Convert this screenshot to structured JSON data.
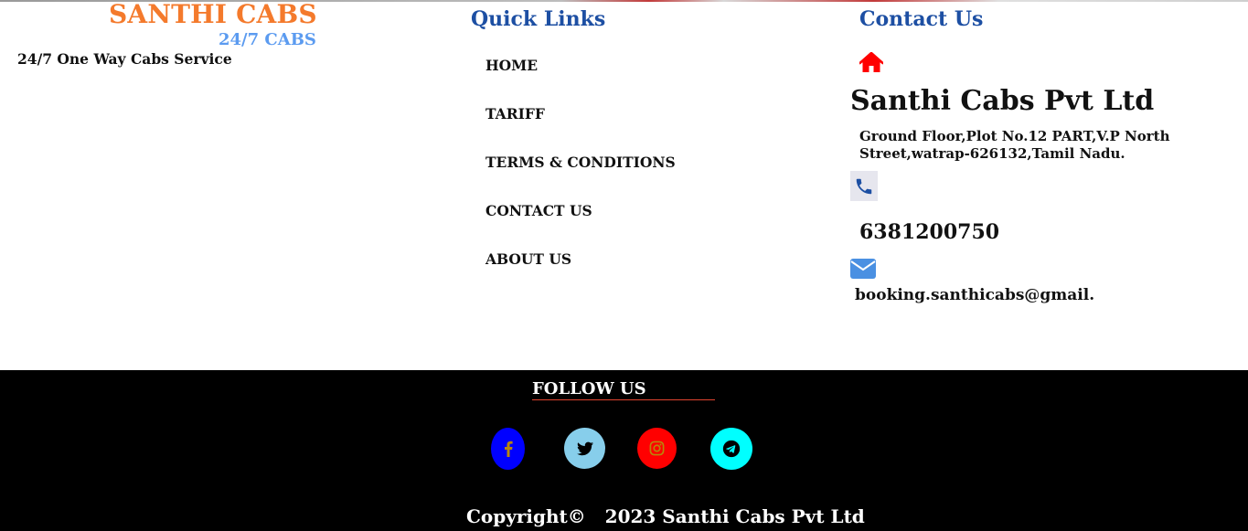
{
  "brand": {
    "title": "SANTHI CABS",
    "subtitle": "24/7 CABS",
    "tagline": "24/7 One Way Cabs Service",
    "title_color": "#f47a2c",
    "subtitle_color": "#5b9bf0"
  },
  "quick_links": {
    "heading": "Quick Links",
    "items": [
      {
        "label": "HOME"
      },
      {
        "label": "TARIFF"
      },
      {
        "label": "TERMS & CONDITIONS"
      },
      {
        "label": "CONTACT US"
      },
      {
        "label": "ABOUT US"
      }
    ]
  },
  "contact": {
    "heading": "Contact Us",
    "home_icon": "home-icon",
    "company": "Santhi Cabs Pvt Ltd",
    "address": "Ground Floor,Plot No.12 PART,V.P North Street,watrap-626132,Tamil Nadu.",
    "phone_icon": "phone-icon",
    "phone": "6381200750",
    "mail_icon": "envelope-icon",
    "email": "booking.santhicabs@gmail."
  },
  "footer": {
    "follow_label": "FOLLOW US",
    "social": [
      {
        "name": "facebook-icon",
        "color": "#0000ff"
      },
      {
        "name": "twitter-icon",
        "color": "#87ceeb"
      },
      {
        "name": "instagram-icon",
        "color": "#ff0000"
      },
      {
        "name": "telegram-icon",
        "color": "#00ffff"
      }
    ],
    "copyright": "Copyright©   2023 Santhi Cabs Pvt Ltd"
  },
  "colors": {
    "heading_blue": "#1d4fa3",
    "footer_bg": "#000000",
    "accent_red": "#e0442f"
  }
}
